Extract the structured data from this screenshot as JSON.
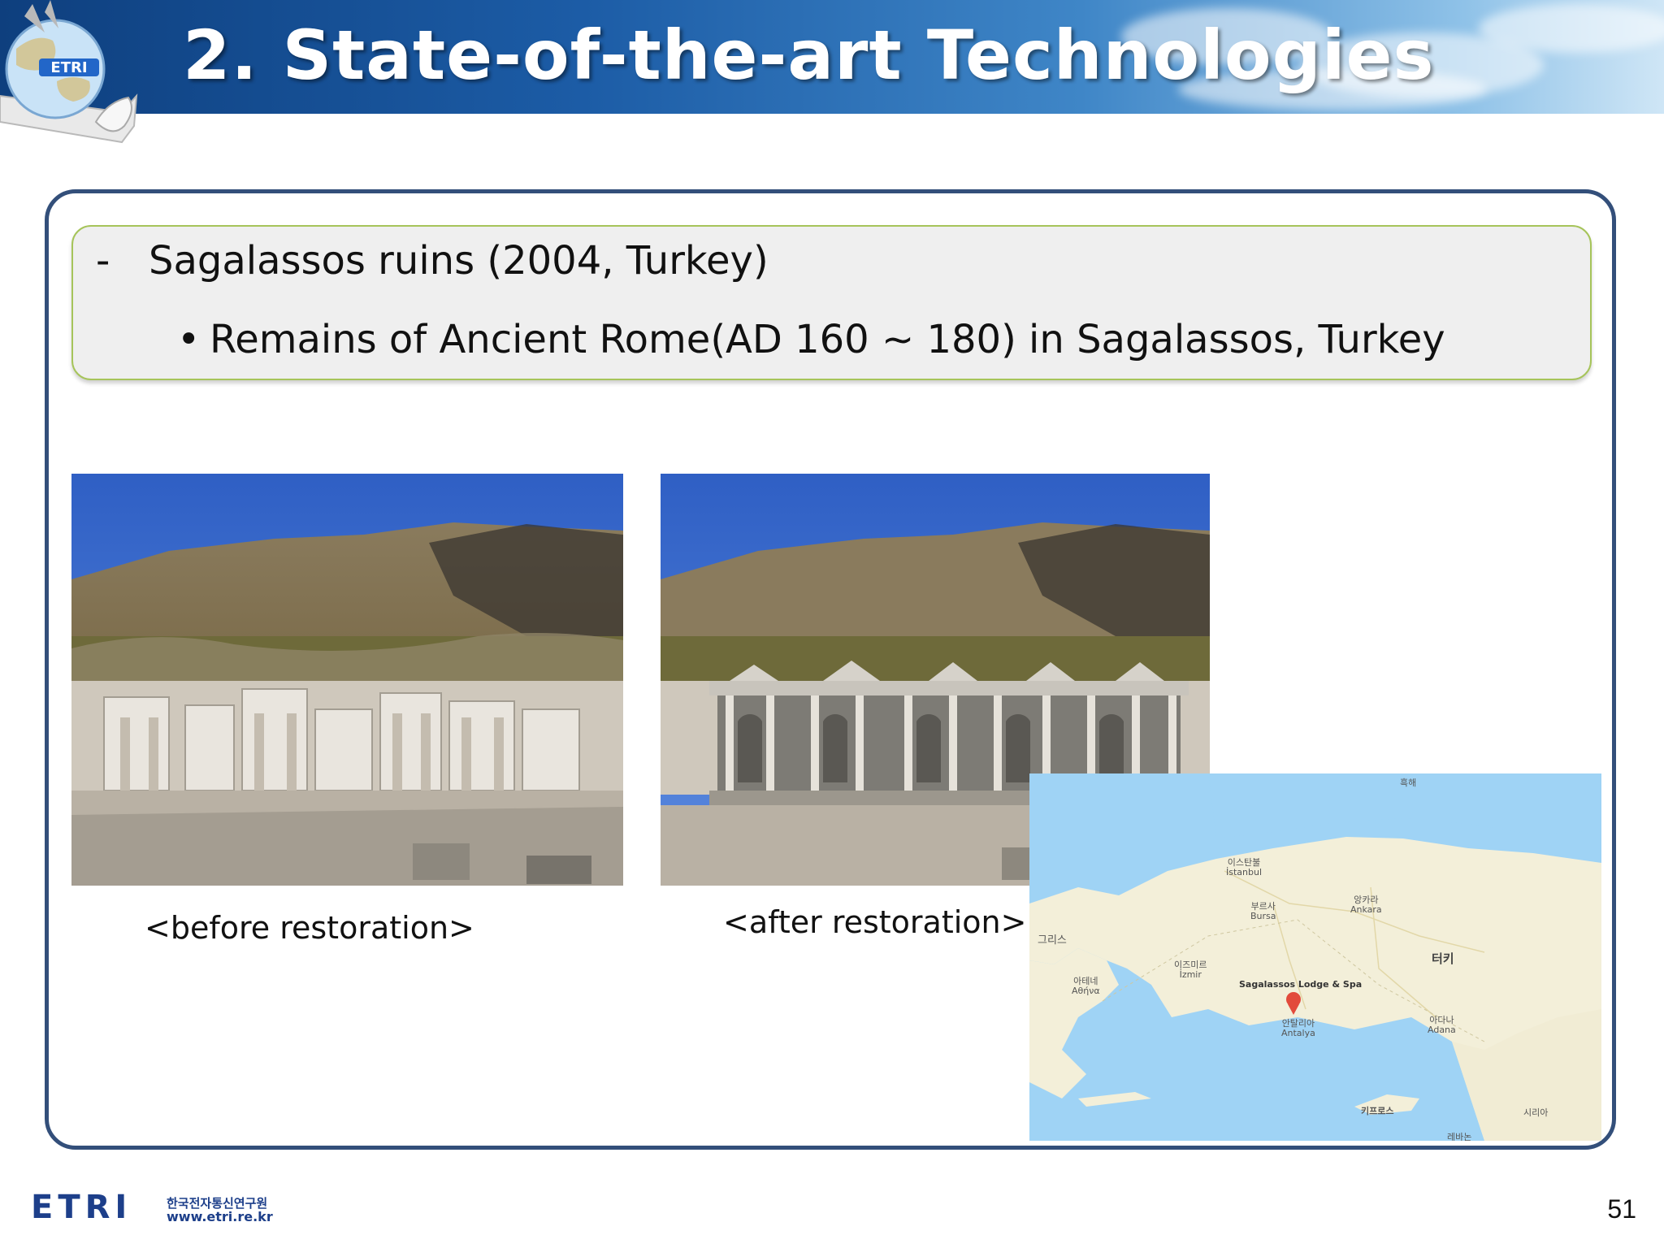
{
  "header": {
    "title": "2. State-of-the-art Technologies",
    "emblem_text": "ETRI"
  },
  "callout": {
    "dash": "-",
    "line1": "Sagalassos ruins (2004, Turkey)",
    "bullet": "•",
    "line2": "Remains of Ancient Rome(AD 160 ~ 180) in Sagalassos, Turkey"
  },
  "captions": {
    "before": "<before restoration>",
    "after": "<after restoration>"
  },
  "map": {
    "labels": {
      "sea": "흑해",
      "istanbul_ko": "이스탄불",
      "istanbul_en": "İstanbul",
      "bursa_ko": "부르사",
      "bursa_en": "Bursa",
      "ankara_ko": "앙카라",
      "ankara_en": "Ankara",
      "greece": "그리스",
      "izmir_ko": "이즈미르",
      "izmir_en": "İzmir",
      "athens_ko": "아테네",
      "athens_en": "Αθήνα",
      "turkey": "터키",
      "lodge": "Sagalassos Lodge & Spa",
      "antalya_ko": "안탈리아",
      "antalya_en": "Antalya",
      "adana_ko": "아다나",
      "adana_en": "Adana",
      "cyprus": "키프로스",
      "syria": "시리아",
      "lebanon": "레바논"
    },
    "colors": {
      "water": "#9fd3f5",
      "land": "#f3efd9",
      "pin": "#e24a3b"
    }
  },
  "footer": {
    "org_ko": "한국전자통신연구원",
    "url": "www.etri.re.kr",
    "logo": "ETRI",
    "page": "51"
  }
}
